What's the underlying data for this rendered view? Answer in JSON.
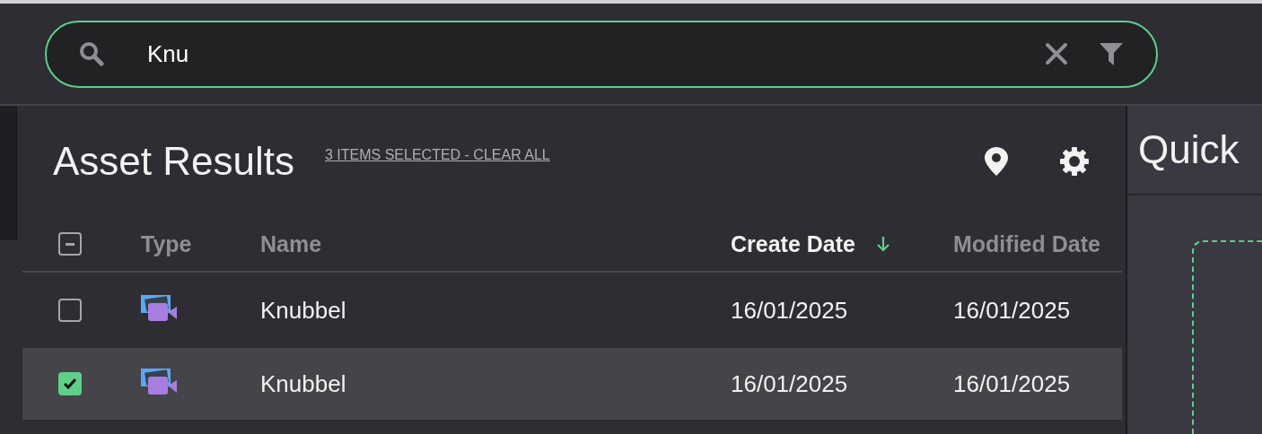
{
  "search": {
    "value": "Knu"
  },
  "results": {
    "title": "Asset Results",
    "selection_link": "3 ITEMS SELECTED - CLEAR ALL",
    "header_checkbox": {
      "indeterminate": true
    },
    "columns": [
      {
        "label": "Type",
        "sorted": false
      },
      {
        "label": "Name",
        "sorted": false
      },
      {
        "label": "Create Date",
        "sorted": true
      },
      {
        "label": "Modified Date",
        "sorted": false
      }
    ],
    "rows": [
      {
        "checked": false,
        "selected": false,
        "kind": "video",
        "name": "Knubbel",
        "create_date": "16/01/2025",
        "modified_date": "16/01/2025"
      },
      {
        "checked": true,
        "selected": true,
        "kind": "video",
        "name": "Knubbel",
        "create_date": "16/01/2025",
        "modified_date": "16/01/2025"
      }
    ]
  },
  "side_panel": {
    "title": "Quick"
  }
}
